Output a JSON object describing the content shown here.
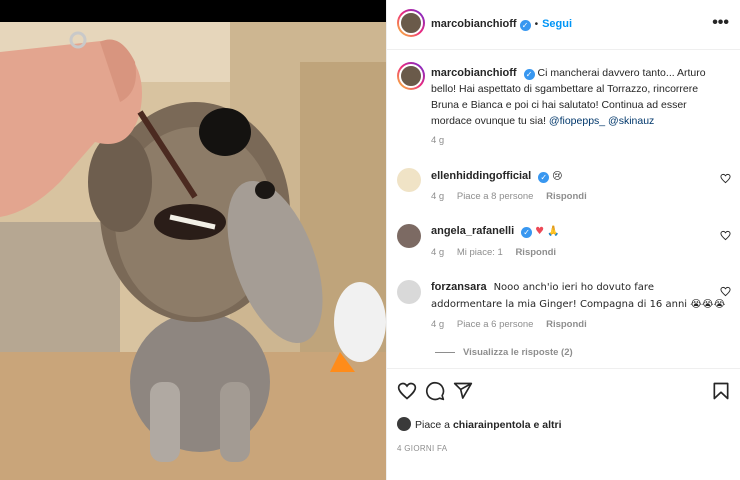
{
  "post": {
    "username": "marcobianchioff",
    "follow_label": "Segui",
    "separator": "•",
    "more_label": "•••"
  },
  "caption": {
    "username": "marcobianchioff",
    "text": "Ci mancherai davvero tanto... Arturo bello! Hai aspettato di sgambettare al Torrazzo, rincorrere Bruna e Bianca e poi ci hai salutato! Continua ad esser mordace ovunque tu sia!",
    "mention1": "@fiopepps_",
    "mention2": "@skinauz",
    "age": "4 g"
  },
  "comments": [
    {
      "username": "ellenhiddingofficial",
      "text": "😢",
      "age": "4 g",
      "likes": "Piace a 8 persone",
      "reply": "Rispondi"
    },
    {
      "username": "angela_rafanelli",
      "text": "♥ 🙏",
      "age": "4 g",
      "likes": "Mi piace: 1",
      "reply": "Rispondi"
    },
    {
      "username": "forzansara",
      "text": "Nooo anch'io ieri ho dovuto fare addormentare la mia Ginger! Compagna di 16 anni 😭😭😭",
      "age": "4 g",
      "likes": "Piace a 6 persone",
      "reply": "Rispondi"
    }
  ],
  "view_replies": "Visualizza le risposte (2)",
  "likes_line": {
    "prefix": "Piace a ",
    "user": "chiarainpentola",
    "suffix": " e altri"
  },
  "timestamp": "4 GIORNI FA",
  "colors": {
    "link": "#0095f6",
    "mention": "#00376b",
    "muted": "#8e8e8e",
    "heart": "#ed4956"
  }
}
